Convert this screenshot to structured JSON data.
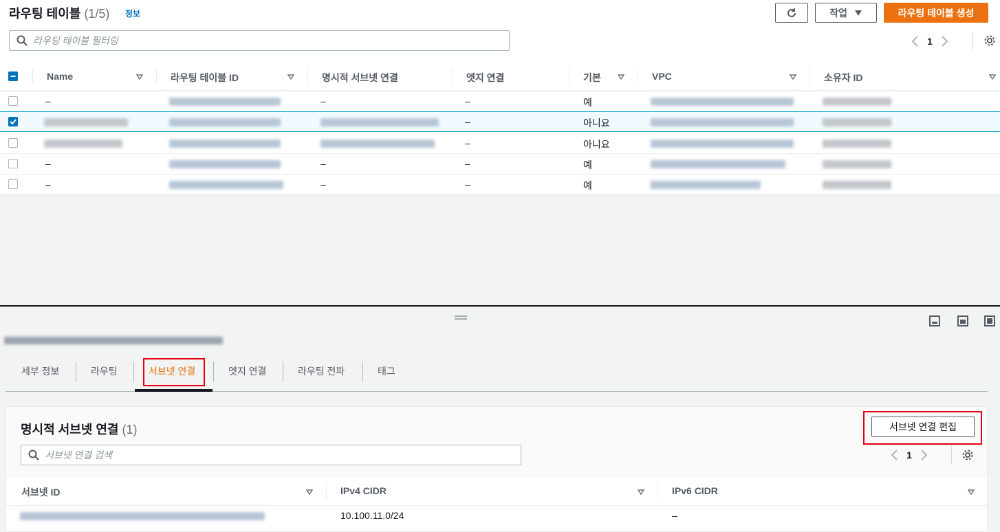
{
  "header": {
    "title": "라우팅 테이블",
    "count": "(1/5)",
    "info_link": "정보",
    "refresh_icon": "refresh-icon",
    "actions_label": "작업",
    "create_label": "라우팅 테이블 생성"
  },
  "search": {
    "placeholder": "라우팅 테이블 필터링"
  },
  "pagination": {
    "page": "1"
  },
  "table": {
    "columns": [
      "Name",
      "라우팅 테이블 ID",
      "명시적 서브넷 연결",
      "엣지 연결",
      "기본",
      "VPC",
      "소유자 ID"
    ],
    "rows": [
      {
        "name": "–",
        "explicit": "–",
        "edge": "–",
        "main": "예",
        "selected": false
      },
      {
        "name": "",
        "explicit": "",
        "edge": "–",
        "main": "아니요",
        "selected": true
      },
      {
        "name": "",
        "explicit": "",
        "edge": "–",
        "main": "아니요",
        "selected": false
      },
      {
        "name": "–",
        "explicit": "–",
        "edge": "–",
        "main": "예",
        "selected": false
      },
      {
        "name": "–",
        "explicit": "–",
        "edge": "–",
        "main": "예",
        "selected": false
      }
    ]
  },
  "tabs": [
    "세부 정보",
    "라우팅",
    "서브넷 연결",
    "엣지 연결",
    "라우팅 전파",
    "태그"
  ],
  "subnet_panel": {
    "title": "명시적 서브넷 연결",
    "count": "(1)",
    "edit_label": "서브넷 연결 편집",
    "search_placeholder": "서브넷 연결 검색",
    "page": "1",
    "columns": [
      "서브넷 ID",
      "IPv4 CIDR",
      "IPv6 CIDR"
    ],
    "rows": [
      {
        "ipv4": "10.100.11.0/24",
        "ipv6": "–"
      }
    ]
  },
  "colors": {
    "accent": "#ec7211",
    "link": "#0073bb",
    "highlight": "#e4000c"
  }
}
